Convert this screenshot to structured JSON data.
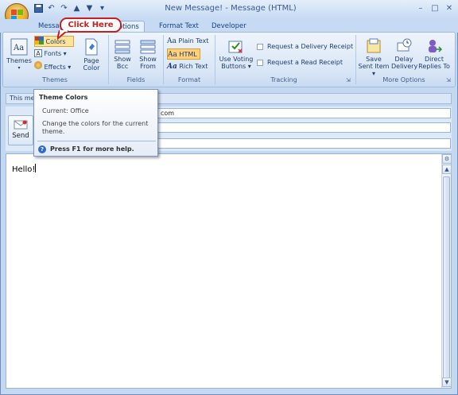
{
  "window": {
    "title": "New Message! - Message (HTML)",
    "controls": {
      "minimize": "–",
      "maximize": "□",
      "close": "✕"
    }
  },
  "qat": {
    "customize": "▾"
  },
  "tabs": [
    {
      "label": "Message"
    },
    {
      "label": "Options",
      "active": true
    },
    {
      "label": "Format Text"
    },
    {
      "label": "Developer"
    }
  ],
  "callout": {
    "label": "Click Here"
  },
  "ribbon": {
    "themes_group": {
      "label": "Themes",
      "themes_btn": "Themes",
      "colors_btn": "Colors",
      "fonts_btn": "Fonts",
      "effects_btn": "Effects",
      "page_color_btn": "Page Color"
    },
    "fields_group": {
      "label": "Fields",
      "show_bcc": "Show Bcc",
      "show_from": "Show From"
    },
    "format_group": {
      "label": "Format",
      "plain_text": "Plain Text",
      "html": "HTML",
      "rich_text": "Rich Text"
    },
    "tracking_group": {
      "label": "Tracking",
      "voting": "Use Voting Buttons",
      "delivery_receipt": "Request a Delivery Receipt",
      "read_receipt": "Request a Read Receipt"
    },
    "more_group": {
      "label": "More Options",
      "save_sent": "Save Sent Item",
      "delay": "Delay Delivery",
      "direct": "Direct Replies To"
    }
  },
  "info_bar": {
    "text": "This me"
  },
  "compose": {
    "send_label": "Send",
    "to_value": "com",
    "body_text": "Hello!"
  },
  "tooltip": {
    "title": "Theme Colors",
    "current": "Current: Office",
    "description": "Change the colors for the current theme.",
    "help": "Press F1 for more help."
  },
  "colors": {
    "accent": "#15428b",
    "callout": "#c81e1e"
  }
}
